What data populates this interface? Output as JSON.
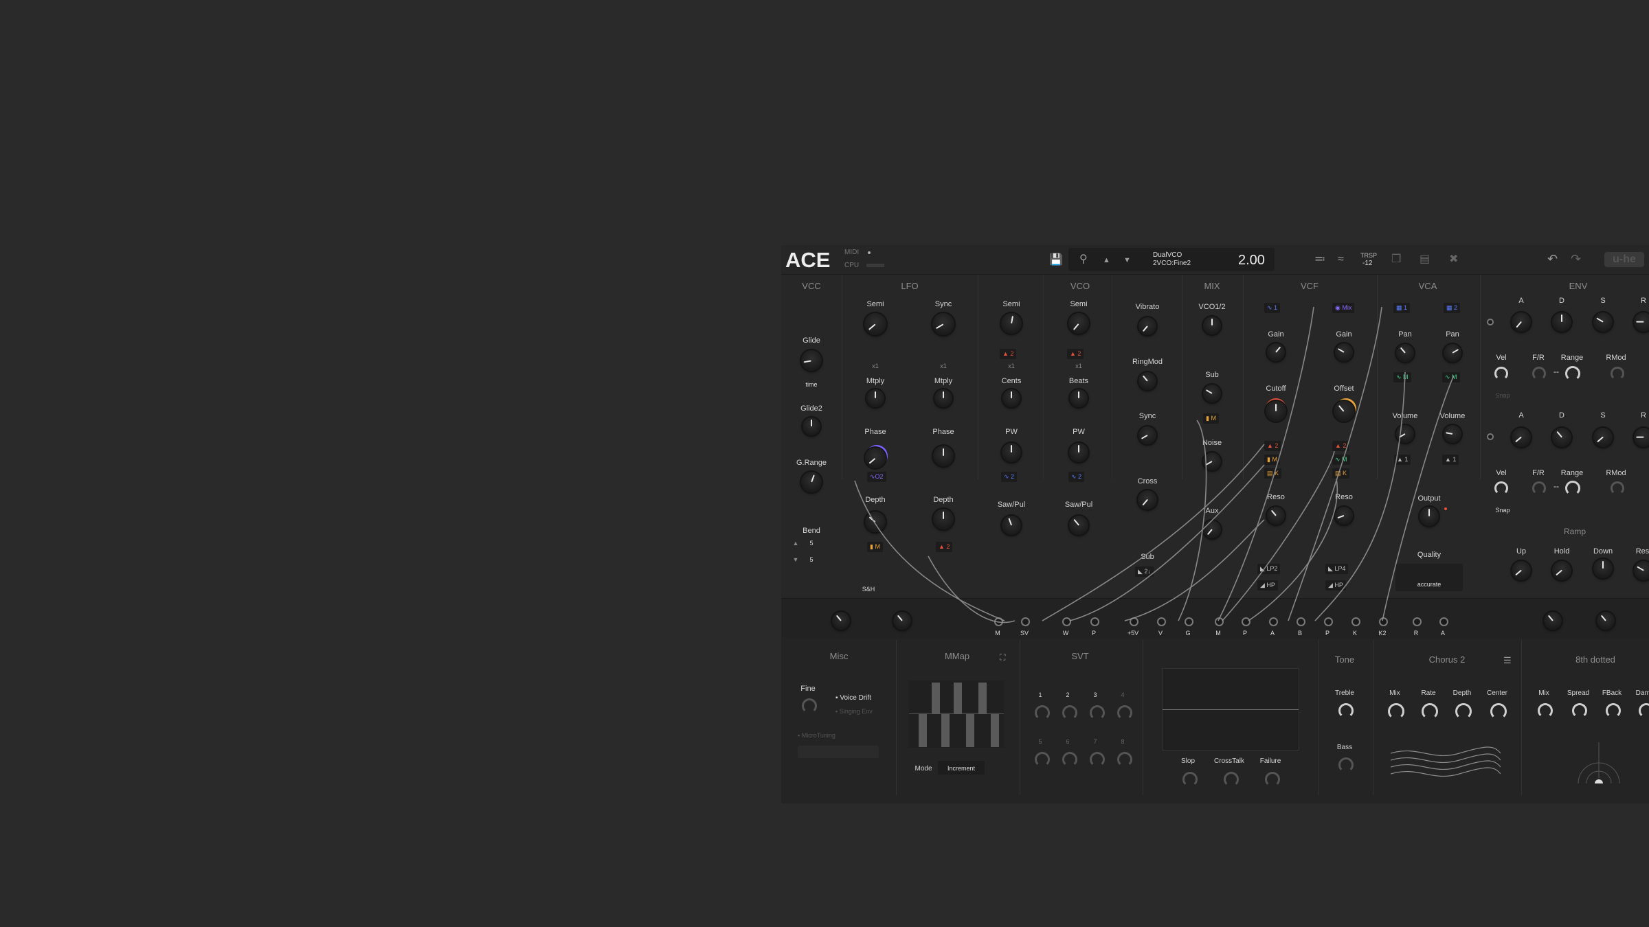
{
  "header": {
    "logo": "ACE",
    "midi_label": "MIDI",
    "cpu_label": "CPU",
    "preset_bank": "DualVCO",
    "preset_name": "2VCO:Fine2",
    "value": "2.00",
    "trsp_label": "TRSP",
    "trsp_value": "-12",
    "brand": "u-he"
  },
  "sections": {
    "vcc": "VCC",
    "lfo": "LFO",
    "vco": "VCO",
    "mix": "MIX",
    "vcf": "VCF",
    "vca": "VCA",
    "env": "ENV",
    "misc": "Misc",
    "mmap": "MMap",
    "svt": "SVT",
    "tone": "Tone",
    "chorus": "Chorus 2",
    "delay": "8th dotted",
    "ramp": "Ramp"
  },
  "vcc": {
    "glide": "Glide",
    "time": "time",
    "glide2": "Glide2",
    "grange": "G.Range",
    "bend": "Bend",
    "bend_up": "5",
    "bend_down": "5"
  },
  "lfo": {
    "semi1": "Semi",
    "semi2": "Sync",
    "x1a": "x1",
    "x1b": "x1",
    "mtply1": "Mtply",
    "mtply2": "Mtply",
    "phase1": "Phase",
    "phase2": "Phase",
    "phase_mod": "O2",
    "depth1": "Depth",
    "depth2": "Depth",
    "depth_mod1": "M",
    "depth_mod2": "2",
    "sh": "S&H"
  },
  "vco": {
    "semi1": "Semi",
    "semi2": "Semi",
    "mod1": "2",
    "mod2": "2",
    "x1a": "x1",
    "x1b": "x1",
    "cents": "Cents",
    "beats": "Beats",
    "pw1": "PW",
    "pw2": "PW",
    "pw_mod1": "2",
    "pw_mod2": "2",
    "sawpul1": "Saw/Pul",
    "sawpul2": "Saw/Pul",
    "vibrato": "Vibrato",
    "ringmod": "RingMod",
    "sync": "Sync",
    "cross": "Cross",
    "sub": "Sub",
    "sub_val": "2"
  },
  "mix": {
    "vco12": "VCO1/2",
    "sub": "Sub",
    "sub_mod": "M",
    "noise": "Noise",
    "aux": "Aux"
  },
  "vcf": {
    "src1": "1",
    "src2": "Mix",
    "gain1": "Gain",
    "gain2": "Gain",
    "cutoff": "Cutoff",
    "offset": "Offset",
    "mods1": [
      "2",
      "M",
      "K"
    ],
    "mods2": [
      "2",
      "M",
      "K"
    ],
    "reso1": "Reso",
    "reso2": "Reso",
    "lp2": "LP2",
    "hp1": "HP",
    "lp4": "LP4",
    "hp2": "HP"
  },
  "vca": {
    "src1": "1",
    "src2": "2",
    "pan1": "Pan",
    "pan2": "Pan",
    "pan_mod1": "M",
    "pan_mod2": "M",
    "vol1": "Volume",
    "vol2": "Volume",
    "vol_mod1": "1",
    "vol_mod2": "1",
    "output": "Output",
    "quality": "Quality",
    "quality_val": "accurate"
  },
  "env": {
    "a": "A",
    "d": "D",
    "s": "S",
    "r": "R",
    "vel": "Vel",
    "fr": "F/R",
    "range": "Range",
    "rmod": "RMod",
    "snap": "Snap",
    "dash": "--",
    "up": "Up",
    "hold": "Hold",
    "down": "Down",
    "rest": "Rest"
  },
  "bus": [
    "M",
    "SV",
    "W",
    "P",
    "+5V",
    "V",
    "G",
    "M",
    "P",
    "A",
    "B",
    "P",
    "K",
    "K2",
    "R",
    "A"
  ],
  "misc": {
    "fine": "Fine",
    "voice_drift": "Voice Drift",
    "singing_env": "Singing Env",
    "microtuning": "MicroTuning"
  },
  "mmap": {
    "mode": "Mode",
    "mode_val": "Increment"
  },
  "svt": {
    "nums": [
      "1",
      "2",
      "3",
      "4",
      "5",
      "6",
      "7",
      "8"
    ],
    "slop": "Slop",
    "crosstalk": "CrossTalk",
    "failure": "Failure"
  },
  "tone": {
    "treble": "Treble",
    "bass": "Bass"
  },
  "chorus": {
    "mix": "Mix",
    "rate": "Rate",
    "depth": "Depth",
    "center": "Center"
  },
  "delay": {
    "mix": "Mix",
    "spread": "Spread",
    "fback": "FBack",
    "damp": "Damp"
  },
  "colors": {
    "bg": "#2a2a2a",
    "panel": "#272727",
    "accent_blue": "#5a7dff",
    "accent_red": "#e0523a",
    "accent_orange": "#e8a23a",
    "accent_green": "#3fd08a",
    "accent_purple": "#8a6cff"
  }
}
